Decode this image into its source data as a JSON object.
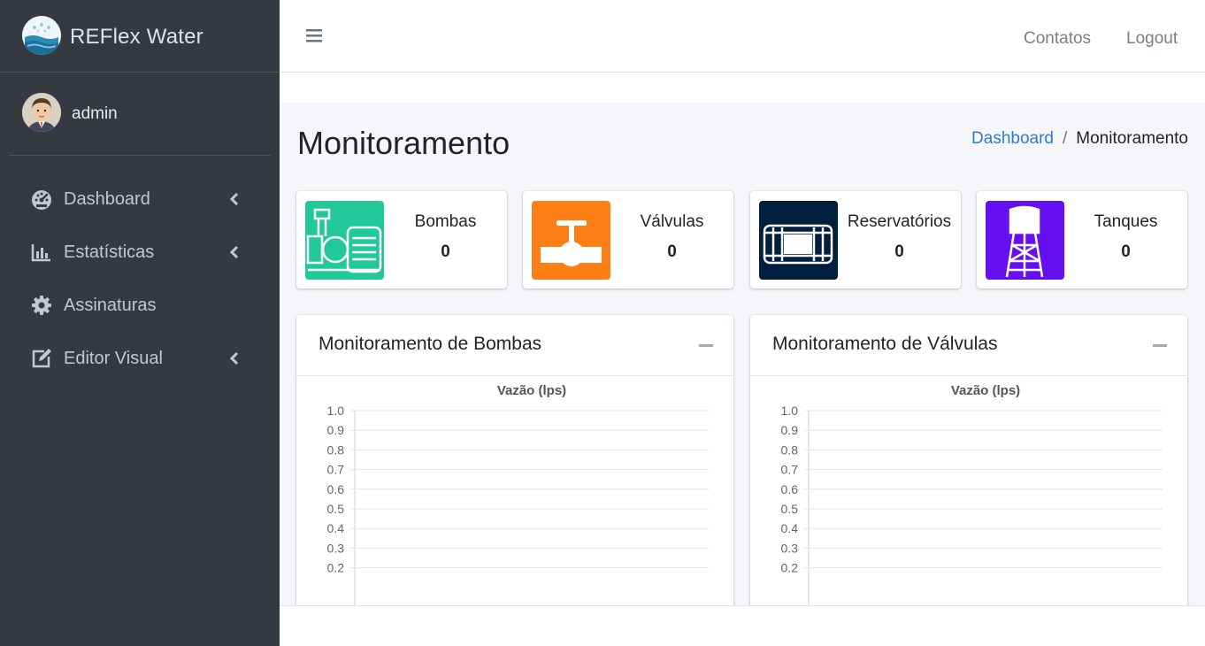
{
  "brand": {
    "name": "REFlex Water"
  },
  "user": {
    "name": "admin"
  },
  "sidebar": {
    "items": [
      {
        "label": "Dashboard",
        "icon": "tachometer-icon",
        "has_arrow": true
      },
      {
        "label": "Estatísticas",
        "icon": "bar-chart-icon",
        "has_arrow": true
      },
      {
        "label": "Assinaturas",
        "icon": "gear-icon",
        "has_arrow": false
      },
      {
        "label": "Editor Visual",
        "icon": "edit-icon",
        "has_arrow": true
      }
    ]
  },
  "topbar": {
    "contacts": "Contatos",
    "logout": "Logout"
  },
  "page": {
    "title": "Monitoramento"
  },
  "breadcrumb": {
    "home": "Dashboard",
    "current": "Monitoramento"
  },
  "info_boxes": [
    {
      "label": "Bombas",
      "value": "0",
      "color": "#20c997",
      "icon": "pump-icon"
    },
    {
      "label": "Válvulas",
      "value": "0",
      "color": "#fd7e14",
      "icon": "valve-icon"
    },
    {
      "label": "Reservatórios",
      "value": "0",
      "color": "#001f3f",
      "icon": "reservoir-icon"
    },
    {
      "label": "Tanques",
      "value": "0",
      "color": "#6610f2",
      "icon": "water-tower-icon"
    }
  ],
  "cards": [
    {
      "title": "Monitoramento de Bombas"
    },
    {
      "title": "Monitoramento de Válvulas"
    }
  ],
  "chart_data": [
    {
      "type": "line",
      "title": "Vazão (lps)",
      "y_ticks": [
        "1.0",
        "0.9",
        "0.8",
        "0.7",
        "0.6",
        "0.5",
        "0.4",
        "0.3",
        "0.2"
      ],
      "ylim": [
        0,
        1
      ],
      "grid": true,
      "series": []
    },
    {
      "type": "line",
      "title": "Vazão (lps)",
      "y_ticks": [
        "1.0",
        "0.9",
        "0.8",
        "0.7",
        "0.6",
        "0.5",
        "0.4",
        "0.3",
        "0.2"
      ],
      "ylim": [
        0,
        1
      ],
      "grid": true,
      "series": []
    }
  ]
}
